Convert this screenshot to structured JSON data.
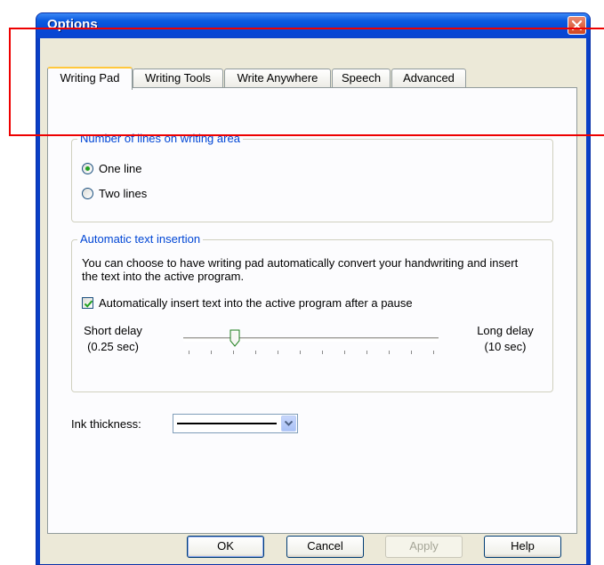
{
  "window": {
    "title": "Options",
    "close_icon": "close-icon"
  },
  "tabs": [
    {
      "label": "Writing Pad",
      "active": true
    },
    {
      "label": "Writing Tools",
      "active": false
    },
    {
      "label": "Write Anywhere",
      "active": false
    },
    {
      "label": "Speech",
      "active": false
    },
    {
      "label": "Advanced",
      "active": false
    }
  ],
  "lines_group": {
    "title": "Number of lines on writing area",
    "options": [
      {
        "label": "One line",
        "checked": true
      },
      {
        "label": "Two lines",
        "checked": false
      }
    ]
  },
  "insertion_group": {
    "title": "Automatic text insertion",
    "description": "You can choose to have writing pad automatically convert your handwriting and insert the text into the active program.",
    "checkbox_label": "Automatically insert text into the active program after a pause",
    "checkbox_checked": true,
    "slider": {
      "min_label_1": "Short delay",
      "min_label_2": "(0.25 sec)",
      "max_label_1": "Long delay",
      "max_label_2": "(10 sec)",
      "position_fraction": 0.19
    }
  },
  "ink": {
    "label": "Ink thickness:",
    "dropdown_icon": "chevron-down-icon"
  },
  "buttons": {
    "ok": "OK",
    "cancel": "Cancel",
    "apply": "Apply",
    "help": "Help"
  },
  "colors": {
    "accent": "#0046d5",
    "annotation": "#ee0000",
    "titlebar": "#0a5ae0"
  }
}
